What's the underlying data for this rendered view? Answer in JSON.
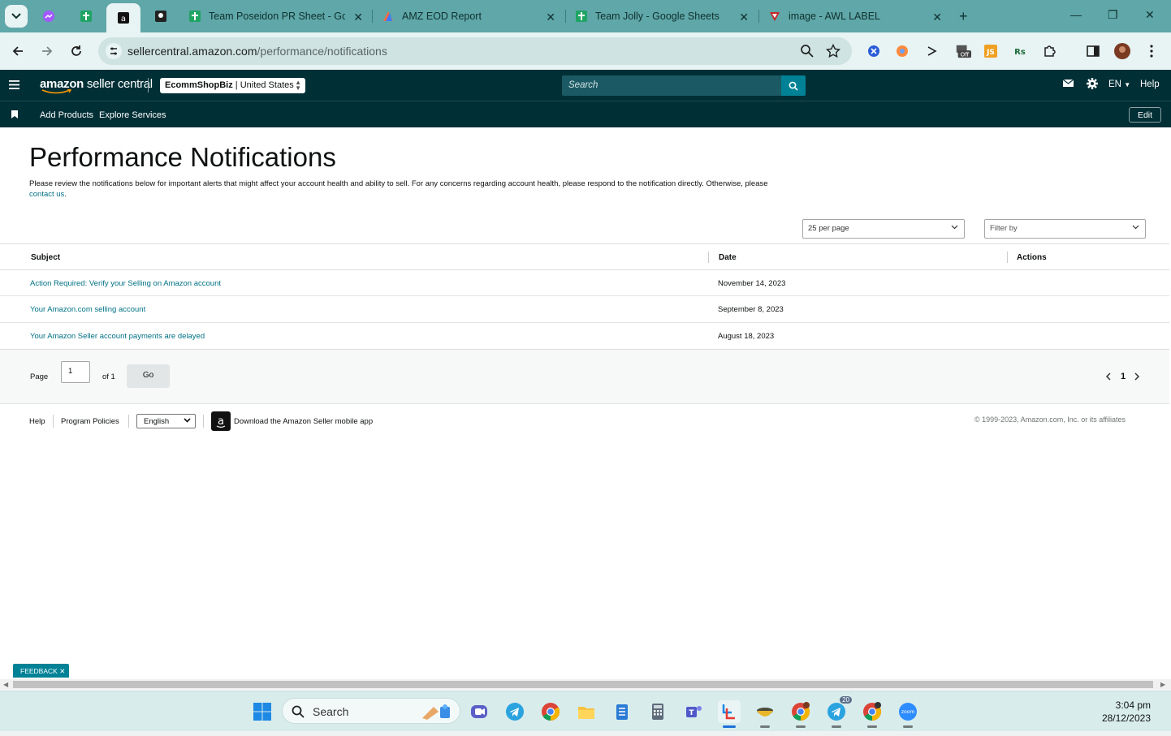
{
  "browser": {
    "tabs": [
      {
        "title": "Team Poseidon PR Sheet - Goo",
        "icon": "google-sheets-icon"
      },
      {
        "title": "AMZ EOD Report",
        "icon": "report-icon"
      },
      {
        "title": "Team Jolly - Google Sheets",
        "icon": "google-sheets-icon"
      },
      {
        "title": "image - AWL LABEL",
        "icon": "awl-icon"
      }
    ],
    "url_host": "sellercentral.amazon.com",
    "url_path": "/performance/notifications",
    "accent": "#5fa7a8"
  },
  "header": {
    "logo_bold": "amazon",
    "logo_light": " seller central",
    "account_store": "EcommShopBiz",
    "account_region": " | United States",
    "search_placeholder": "Search",
    "lang": "EN",
    "help": "Help"
  },
  "subnav": {
    "links": [
      "Add Products",
      "Explore Services"
    ],
    "edit": "Edit"
  },
  "main": {
    "title": "Performance Notifications",
    "description": "Please review the notifications below for important alerts that might affect your account health and ability to sell. For any concerns regarding account health, please respond to the notification directly. Otherwise, please",
    "contact_link": "contact us",
    "per_page": "25 per page",
    "filter": "Filter by"
  },
  "table": {
    "headers": [
      "Subject",
      "Date",
      "Actions"
    ],
    "rows": [
      {
        "subject": "Action Required: Verify your Selling on Amazon account",
        "date": "November 14, 2023"
      },
      {
        "subject": "Your Amazon.com selling account",
        "date": "September 8, 2023"
      },
      {
        "subject": "Your Amazon Seller account payments are delayed",
        "date": "August 18, 2023"
      }
    ]
  },
  "pager": {
    "page_label": "Page",
    "page_value": "1",
    "of_label": "of 1",
    "go": "Go",
    "current": "1"
  },
  "footer": {
    "help": "Help",
    "policies": "Program Policies",
    "language": "English",
    "app": "Download the Amazon Seller mobile app",
    "copyright": "© 1999-2023, Amazon.com, Inc. or its affiliates"
  },
  "feedback": "FEEDBACK",
  "taskbar": {
    "search": "Search",
    "time": "3:04 pm",
    "date": "28/12/2023",
    "telegram_badge": "20"
  }
}
